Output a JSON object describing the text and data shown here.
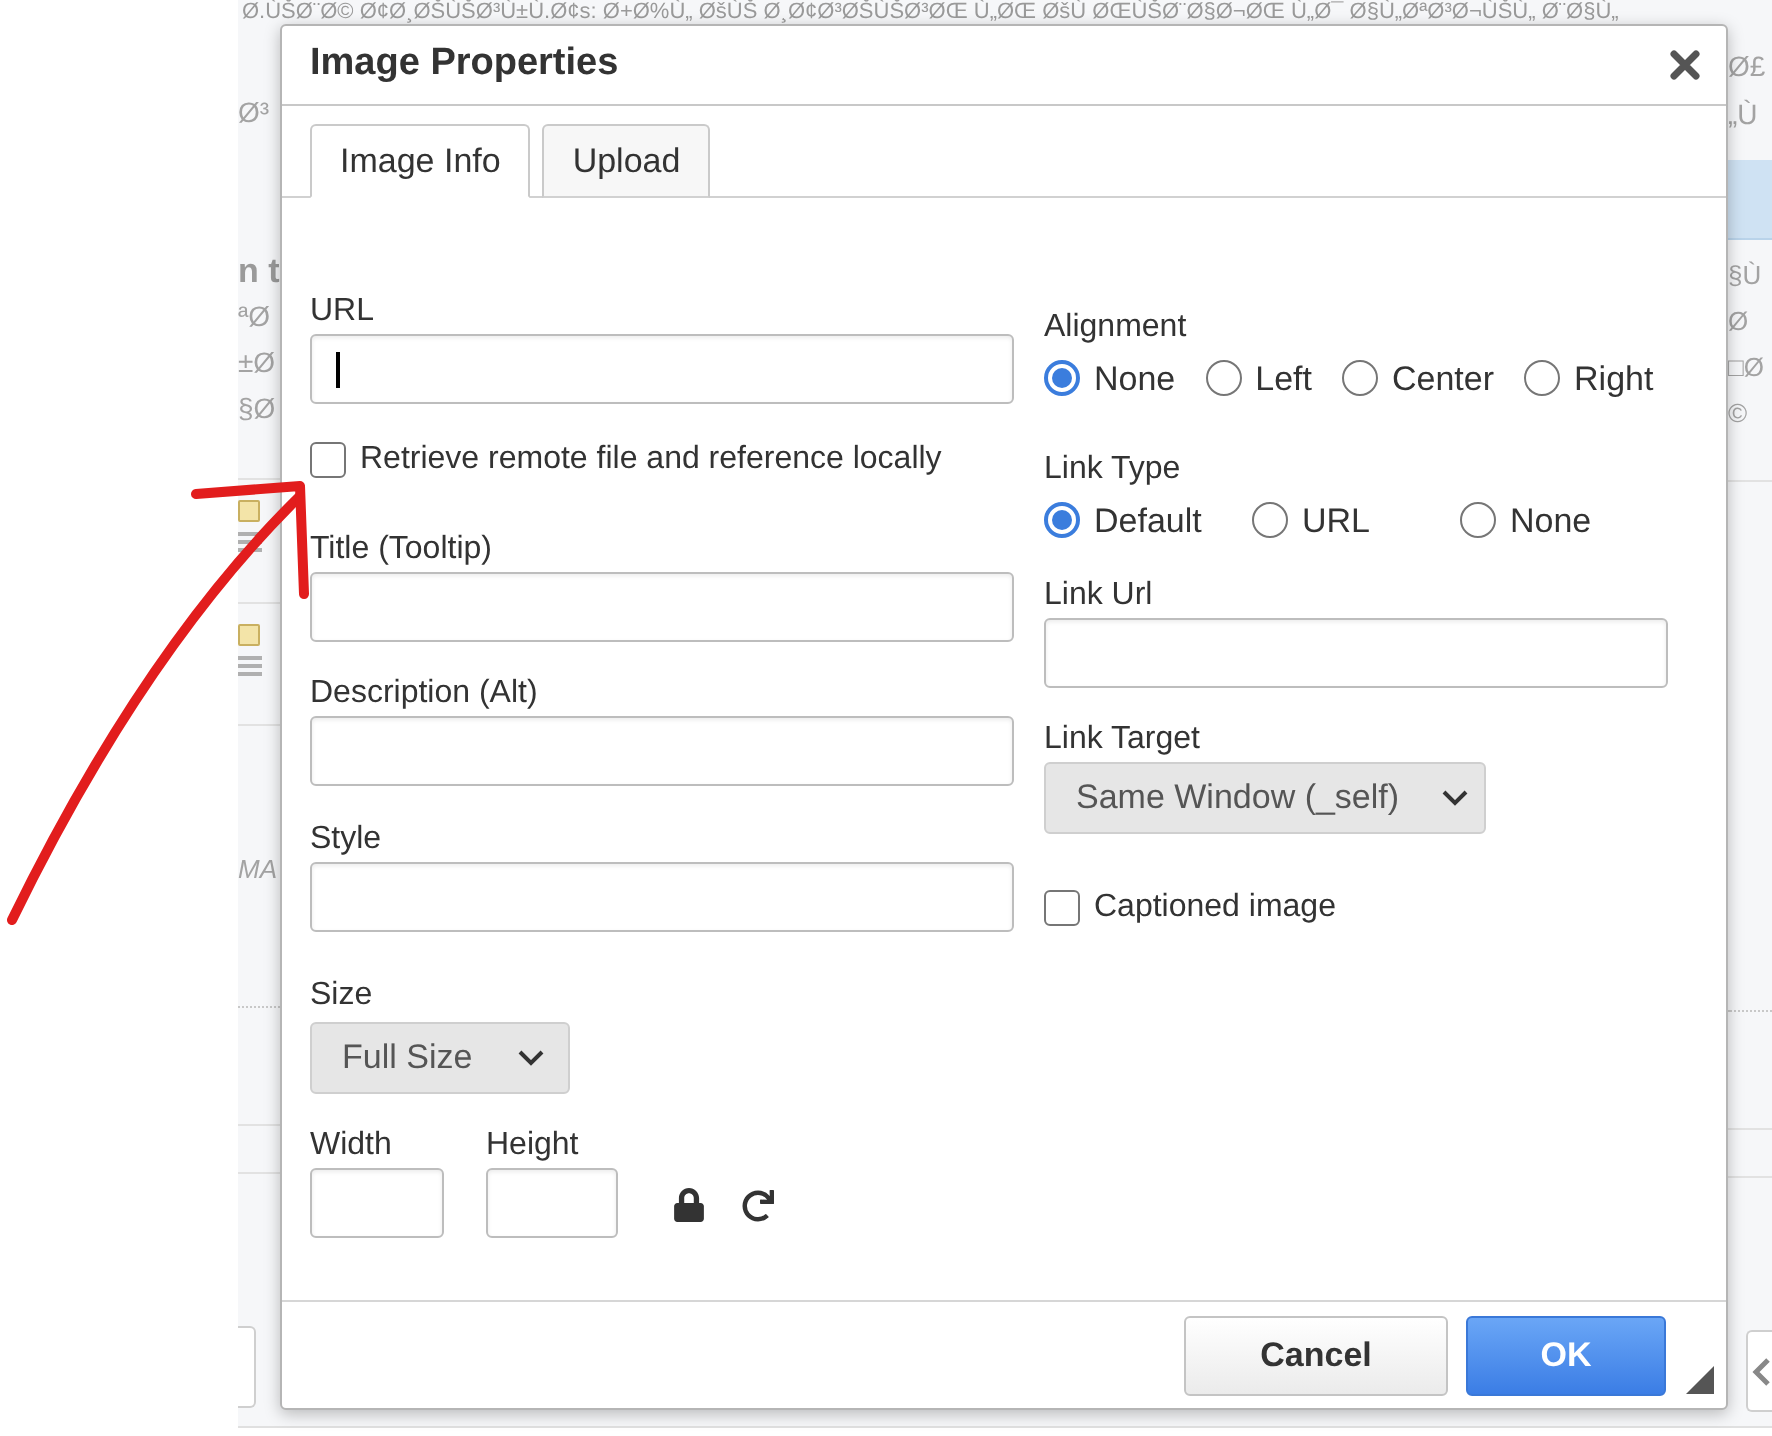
{
  "background": {
    "top_text": "Ø.ÙŠØ¨Ø© Ø¢Ø¸ØŠÙŠØ³Ù±Ù.Ø¢s: Ø+Ø%Ù„ ØšÙŠ Ø¸Ø¢Ø³ØŠÙŠØ³ØŒ Ù„ØŒ ØšÙ ØŒÙŠØ¨Ø§Ø¬ØŒ Ù„Ø¯ Ø§Ù„ØªØ³Ø¬ÙŠÙ„ Ø¨Ø§Ù„",
    "left_edge": {
      "upper": "Ø³",
      "heading": "n t",
      "lines": [
        "ªØ",
        "±Ø",
        "§Ø"
      ],
      "italic": "MA"
    },
    "right_edge": {
      "upper_lines": [
        "Ø£",
        "„Ù"
      ],
      "lines": [
        "§Ù",
        "Ø",
        "□Ø",
        "©"
      ]
    }
  },
  "dialog": {
    "title": "Image Properties",
    "tabs": [
      {
        "label": "Image Info",
        "selected": true
      },
      {
        "label": "Upload",
        "selected": false
      }
    ],
    "url": {
      "label": "URL",
      "focused": true
    },
    "retrieve_remote": {
      "label": "Retrieve remote file and reference locally",
      "checked": false
    },
    "title_field": {
      "label": "Title (Tooltip)"
    },
    "description": {
      "label": "Description (Alt)"
    },
    "style": {
      "label": "Style"
    },
    "size": {
      "label": "Size",
      "value": "Full Size"
    },
    "width": {
      "label": "Width"
    },
    "height": {
      "label": "Height"
    },
    "alignment": {
      "label": "Alignment",
      "options": [
        {
          "label": "None",
          "selected": true
        },
        {
          "label": "Left",
          "selected": false
        },
        {
          "label": "Center",
          "selected": false
        },
        {
          "label": "Right",
          "selected": false
        }
      ]
    },
    "link_type": {
      "label": "Link Type",
      "options": [
        {
          "label": "Default",
          "selected": true
        },
        {
          "label": "URL",
          "selected": false
        },
        {
          "label": "None",
          "selected": false
        }
      ]
    },
    "link_url": {
      "label": "Link Url"
    },
    "link_target": {
      "label": "Link Target",
      "value": "Same Window (_self)"
    },
    "captioned": {
      "label": "Captioned image",
      "checked": false
    },
    "buttons": [
      {
        "label": "Cancel",
        "kind": "secondary"
      },
      {
        "label": "OK",
        "kind": "primary"
      }
    ]
  }
}
